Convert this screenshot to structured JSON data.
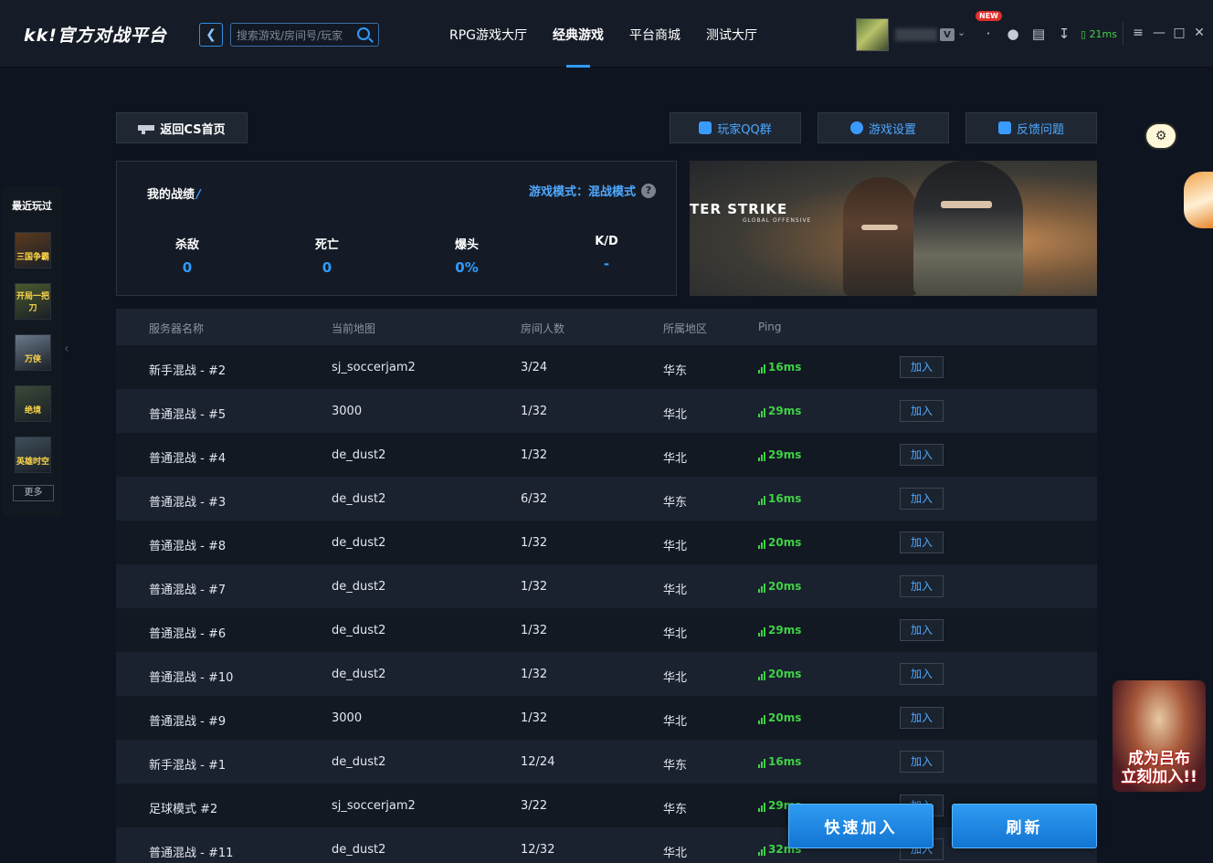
{
  "app": {
    "logo_text": "kk!官方对战平台",
    "search_placeholder": "搜索游戏/房间号/玩家",
    "nav_tabs": [
      {
        "label": "RPG游戏大厅",
        "active": false
      },
      {
        "label": "经典游戏",
        "active": true
      },
      {
        "label": "平台商城",
        "active": false
      },
      {
        "label": "测试大厅",
        "active": false
      }
    ],
    "new_badge": "NEW",
    "vip_badge": "V",
    "ping": "21ms",
    "accent_color": "#2f9bff",
    "ping_color": "#3fd145"
  },
  "sidebar": {
    "title": "最近玩过",
    "games": [
      {
        "label": "三国争霸",
        "color": "#5a3a1e"
      },
      {
        "label": "开局一把刀",
        "color": "#4a5a2e"
      },
      {
        "label": "万侠",
        "color": "#6a7a8a"
      },
      {
        "label": "绝境",
        "color": "#3a4a38"
      },
      {
        "label": "英雄时空",
        "color": "#3e4e5a"
      }
    ],
    "more_label": "更多"
  },
  "toolbar": {
    "back_label": "返回CS首页",
    "qq_label": "玩家QQ群",
    "settings_label": "游戏设置",
    "feedback_label": "反馈问题"
  },
  "stats": {
    "title": "我的战绩",
    "mode_label": "游戏模式：混战模式",
    "help_icon": "?",
    "items": [
      {
        "label": "杀敌",
        "value": "0"
      },
      {
        "label": "死亡",
        "value": "0"
      },
      {
        "label": "爆头",
        "value": "0%"
      },
      {
        "label": "K/D",
        "value": "-"
      }
    ]
  },
  "banner": {
    "title": "TER STRIKE",
    "subtitle": "GLOBAL OFFENSIVE"
  },
  "table": {
    "headers": [
      "服务器名称",
      "当前地图",
      "房间人数",
      "所属地区",
      "Ping"
    ],
    "join_label": "加入",
    "rows": [
      {
        "name": "新手混战 - #2",
        "map": "sj_soccerjam2",
        "players": "3/24",
        "region": "华东",
        "ping": "16ms"
      },
      {
        "name": "普通混战 - #5",
        "map": "3000",
        "players": "1/32",
        "region": "华北",
        "ping": "29ms"
      },
      {
        "name": "普通混战 - #4",
        "map": "de_dust2",
        "players": "1/32",
        "region": "华北",
        "ping": "29ms"
      },
      {
        "name": "普通混战 - #3",
        "map": "de_dust2",
        "players": "6/32",
        "region": "华东",
        "ping": "16ms"
      },
      {
        "name": "普通混战 - #8",
        "map": "de_dust2",
        "players": "1/32",
        "region": "华北",
        "ping": "20ms"
      },
      {
        "name": "普通混战 - #7",
        "map": "de_dust2",
        "players": "1/32",
        "region": "华北",
        "ping": "20ms"
      },
      {
        "name": "普通混战 - #6",
        "map": "de_dust2",
        "players": "1/32",
        "region": "华北",
        "ping": "29ms"
      },
      {
        "name": "普通混战 - #10",
        "map": "de_dust2",
        "players": "1/32",
        "region": "华北",
        "ping": "20ms"
      },
      {
        "name": "普通混战 - #9",
        "map": "3000",
        "players": "1/32",
        "region": "华北",
        "ping": "20ms"
      },
      {
        "name": "新手混战 - #1",
        "map": "de_dust2",
        "players": "12/24",
        "region": "华东",
        "ping": "16ms"
      },
      {
        "name": "足球模式 #2",
        "map": "sj_soccerjam2",
        "players": "3/22",
        "region": "华东",
        "ping": "29ms"
      },
      {
        "name": "普通混战 - #11",
        "map": "de_dust2",
        "players": "12/32",
        "region": "华北",
        "ping": "32ms"
      }
    ]
  },
  "actions": {
    "quick_join_label": "快速加入",
    "refresh_label": "刷新"
  },
  "float_ad": {
    "text_line1": "成为吕布",
    "text_line2": "立刻加入!!"
  }
}
